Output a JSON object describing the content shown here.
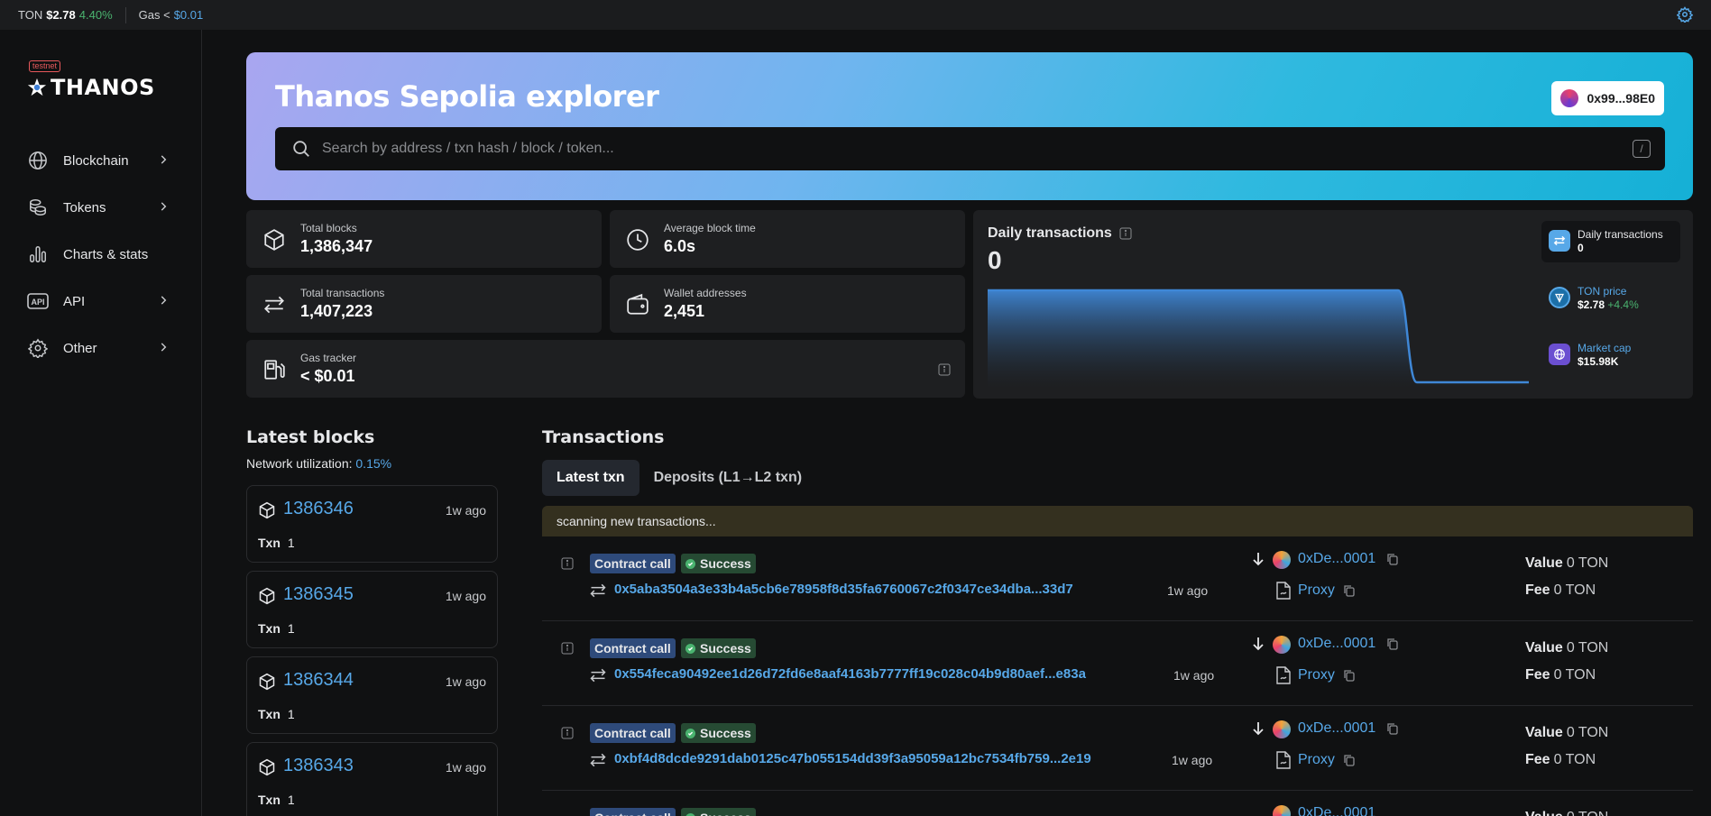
{
  "topbar": {
    "ton_label": "TON",
    "ton_price": "$2.78",
    "ton_change": "4.40%",
    "gas_label": "Gas <",
    "gas_value": "$0.01"
  },
  "sidebar": {
    "badge": "testnet",
    "logo_text": "THANOS",
    "items": [
      {
        "label": "Blockchain",
        "icon": "globe-icon",
        "has_chevron": true
      },
      {
        "label": "Tokens",
        "icon": "coins-icon",
        "has_chevron": true
      },
      {
        "label": "Charts & stats",
        "icon": "chart-icon",
        "has_chevron": false
      },
      {
        "label": "API",
        "icon": "api-icon",
        "has_chevron": true
      },
      {
        "label": "Other",
        "icon": "gear-icon",
        "has_chevron": true
      }
    ]
  },
  "hero": {
    "title": "Thanos Sepolia explorer",
    "wallet": "0x99...98E0",
    "search_placeholder": "Search by address / txn hash / block / token...",
    "search_shortcut": "/"
  },
  "stats": {
    "total_blocks": {
      "label": "Total blocks",
      "value": "1,386,347"
    },
    "avg_block_time": {
      "label": "Average block time",
      "value": "6.0s"
    },
    "total_transactions": {
      "label": "Total transactions",
      "value": "1,407,223"
    },
    "wallet_addresses": {
      "label": "Wallet addresses",
      "value": "2,451"
    },
    "gas_tracker": {
      "label": "Gas tracker",
      "value": "< $0.01"
    }
  },
  "daily": {
    "title": "Daily transactions",
    "value": "0",
    "minis": [
      {
        "label": "Daily transactions",
        "value": "0",
        "change": ""
      },
      {
        "label": "TON price",
        "value": "$2.78",
        "change": "+4.4%"
      },
      {
        "label": "Market cap",
        "value": "$15.98K",
        "change": ""
      }
    ]
  },
  "chart_data": {
    "type": "area",
    "title": "Daily transactions",
    "series": [
      {
        "values": [
          1,
          1,
          1,
          1,
          1,
          1,
          1,
          1,
          1,
          1,
          1,
          1,
          1,
          1,
          1,
          1,
          1,
          1,
          1,
          1,
          1,
          1,
          1,
          0,
          0,
          0,
          0,
          0,
          0,
          0
        ]
      }
    ],
    "grid": false
  },
  "latest_blocks": {
    "title": "Latest blocks",
    "util_label": "Network utilization:",
    "util_value": "0.15%",
    "txn_label": "Txn",
    "blocks": [
      {
        "number": "1386346",
        "age": "1w ago",
        "txn": "1"
      },
      {
        "number": "1386345",
        "age": "1w ago",
        "txn": "1"
      },
      {
        "number": "1386344",
        "age": "1w ago",
        "txn": "1"
      },
      {
        "number": "1386343",
        "age": "1w ago",
        "txn": "1"
      }
    ]
  },
  "transactions": {
    "title": "Transactions",
    "tabs": [
      "Latest txn",
      "Deposits (L1→L2 txn)"
    ],
    "scanning": "scanning new transactions...",
    "type_tag": "Contract call",
    "status_tag": "Success",
    "value_label": "Value",
    "fee_label": "Fee",
    "rows": [
      {
        "hash": "0x5aba3504a3e33b4a5cb6e78958f8d35fa6760067c2f0347ce34dba...33d7",
        "age": "1w ago",
        "from": "0xDe...0001",
        "to": "Proxy",
        "value": "0 TON",
        "fee": "0 TON"
      },
      {
        "hash": "0x554feca90492ee1d26d72fd6e8aaf4163b7777ff19c028c04b9d80aef...e83a",
        "age": "1w ago",
        "from": "0xDe...0001",
        "to": "Proxy",
        "value": "0 TON",
        "fee": "0 TON"
      },
      {
        "hash": "0xbf4d8dcde9291dab0125c47b055154dd39f3a95059a12bc7534fb759...2e19",
        "age": "1w ago",
        "from": "0xDe...0001",
        "to": "Proxy",
        "value": "0 TON",
        "fee": "0 TON"
      }
    ]
  },
  "colors": {
    "accent": "#57a8e8",
    "success": "#4ab36f"
  }
}
